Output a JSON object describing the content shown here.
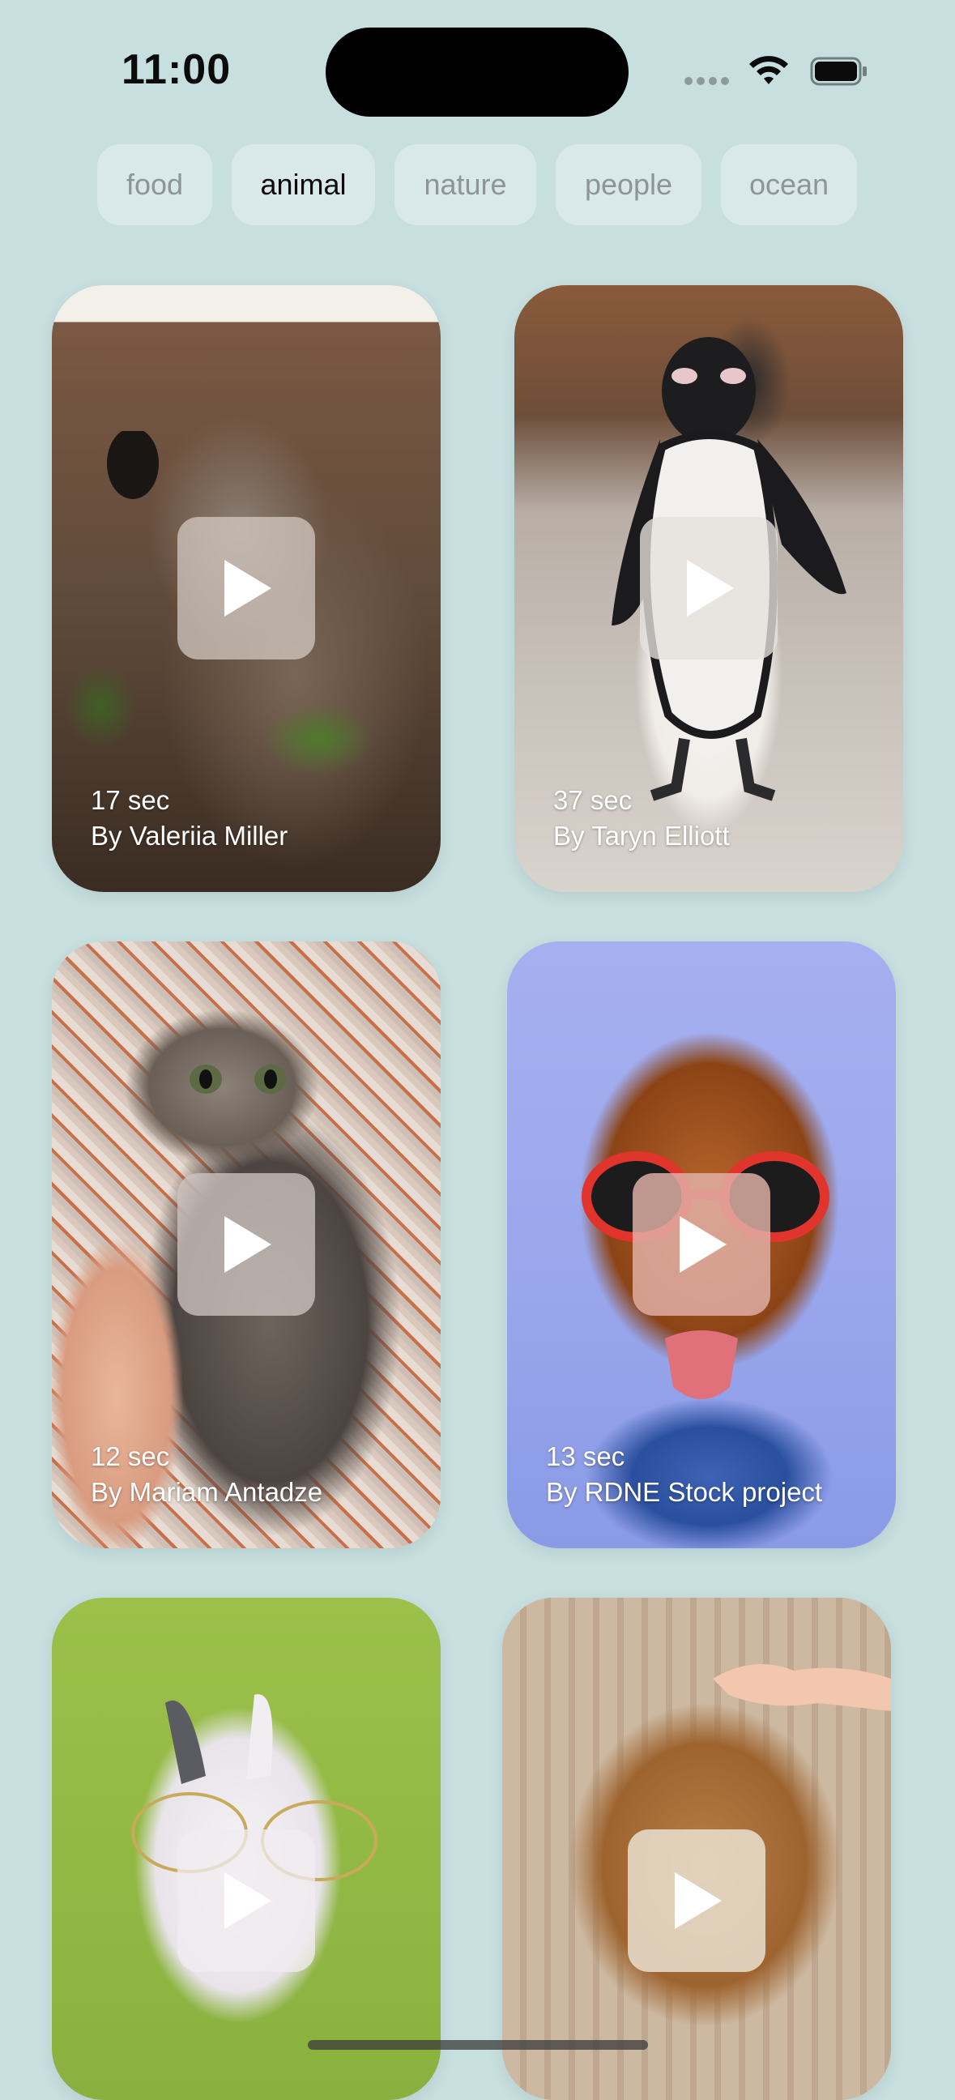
{
  "status_bar": {
    "time": "11:00",
    "icons": [
      "signal-icon",
      "wifi-icon",
      "battery-icon"
    ]
  },
  "tags": [
    {
      "label": "food",
      "active": false
    },
    {
      "label": "animal",
      "active": true
    },
    {
      "label": "nature",
      "active": false
    },
    {
      "label": "people",
      "active": false
    },
    {
      "label": "ocean",
      "active": false
    }
  ],
  "videos": [
    {
      "duration": "17 sec",
      "author": "By Valeriia Miller",
      "subject": "koala",
      "icon": "play-icon"
    },
    {
      "duration": "37 sec",
      "author": "By Taryn Elliott",
      "subject": "penguin",
      "icon": "play-icon"
    },
    {
      "duration": "12 sec",
      "author": "By Mariam Antadze",
      "subject": "kitten",
      "icon": "play-icon"
    },
    {
      "duration": "13 sec",
      "author": "By RDNE Stock project",
      "subject": "dog with glasses",
      "icon": "play-icon"
    },
    {
      "duration": "",
      "author": "",
      "subject": "rabbit with glasses",
      "icon": "play-icon"
    },
    {
      "duration": "",
      "author": "",
      "subject": "calf",
      "icon": "play-icon"
    }
  ],
  "colors": {
    "background": "#c7dfdf",
    "tag_background": "#d9e9e9",
    "tag_text": "#8d9596",
    "tag_active_text": "#0c0c0c"
  }
}
